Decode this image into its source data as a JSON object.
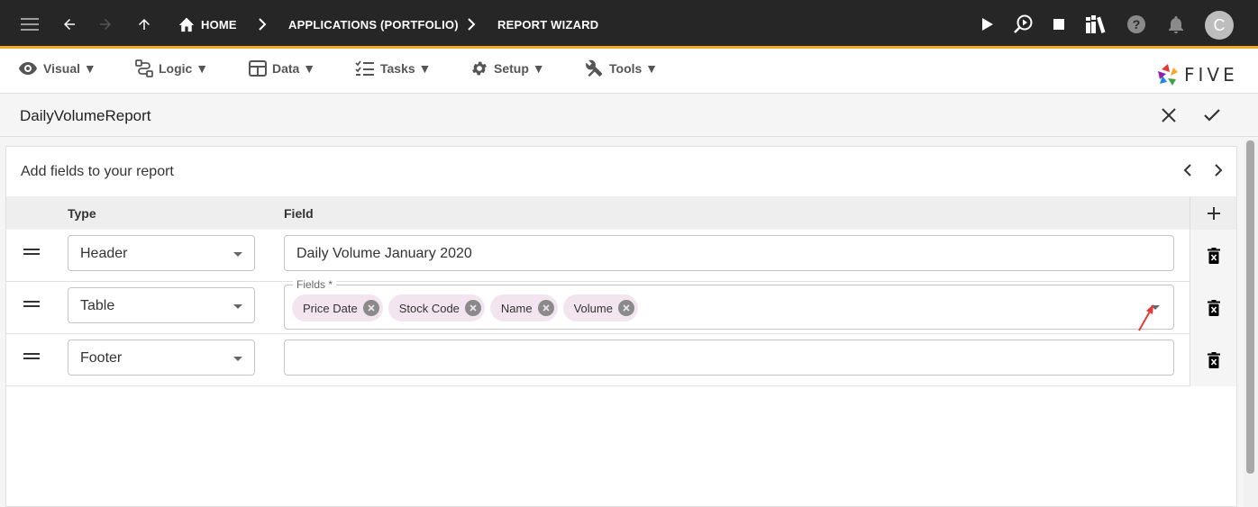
{
  "topbar": {
    "breadcrumbs": [
      "HOME",
      "APPLICATIONS (PORTFOLIO)",
      "REPORT WIZARD"
    ],
    "user_initial": "C",
    "icons": [
      "menu-icon",
      "back-icon",
      "forward-icon",
      "up-icon",
      "home-icon",
      "run-icon",
      "debug-icon",
      "stop-icon",
      "library-icon",
      "help-icon",
      "notifications-icon"
    ],
    "accent_color": "#f5a623"
  },
  "menubar": {
    "items": [
      {
        "label": "Visual ▼",
        "icon": "eye-icon"
      },
      {
        "label": "Logic ▼",
        "icon": "logic-icon"
      },
      {
        "label": "Data ▼",
        "icon": "table-icon"
      },
      {
        "label": "Tasks ▼",
        "icon": "checklist-icon"
      },
      {
        "label": "Setup ▼",
        "icon": "gear-icon"
      },
      {
        "label": "Tools ▼",
        "icon": "tools-icon"
      }
    ],
    "logo_text": "FIVE"
  },
  "header": {
    "title": "DailyVolumeReport"
  },
  "wizard": {
    "step_title": "Add fields to your report",
    "columns": {
      "type": "Type",
      "field": "Field"
    },
    "rows": [
      {
        "type": "Header",
        "field_value": "Daily Volume January 2020"
      },
      {
        "type": "Table",
        "fields_label": "Fields *",
        "chips": [
          "Price Date",
          "Stock Code",
          "Name",
          "Volume"
        ]
      },
      {
        "type": "Footer",
        "field_value": ""
      }
    ]
  },
  "annotation": {
    "arrow_color": "#e53935"
  }
}
